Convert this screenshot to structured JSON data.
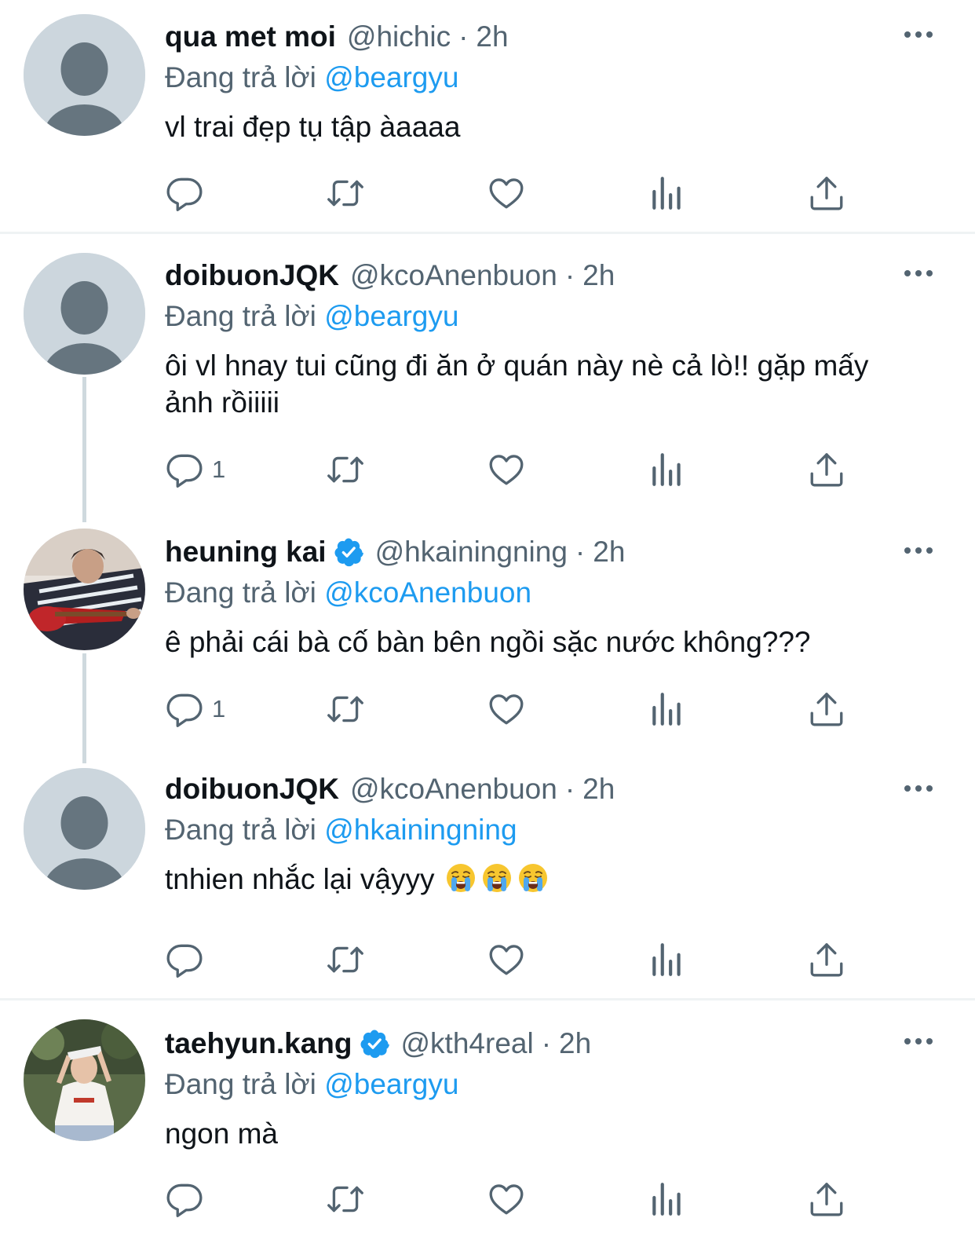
{
  "replying_prefix": "Đang trả lời",
  "tweets": [
    {
      "name": "qua met moi",
      "handle": "@hichic",
      "time": "2h",
      "replying_to": "@beargyu",
      "text": "vl trai đẹp tụ tập àaaaa",
      "reply_count": ""
    },
    {
      "name": "doibuonJQK",
      "handle": "@kcoAnenbuon",
      "time": "2h",
      "replying_to": "@beargyu",
      "text": "ôi vl hnay tui cũng đi ăn ở quán này nè cả lò!! gặp mấy ảnh rồiiiii",
      "reply_count": "1"
    },
    {
      "name": "heuning kai",
      "handle": "@hkainingning",
      "time": "2h",
      "replying_to": "@kcoAnenbuon",
      "text": "ê phải cái bà cố bàn bên ngồi sặc nước không???",
      "reply_count": "1",
      "verified": true
    },
    {
      "name": "doibuonJQK",
      "handle": "@kcoAnenbuon",
      "time": "2h",
      "replying_to": "@hkainingning",
      "text": "tnhien nhắc lại vậyyy",
      "reply_count": "",
      "emojis": [
        "loudly-crying-face-emoji",
        "loudly-crying-face-emoji",
        "loudly-crying-face-emoji"
      ]
    },
    {
      "name": "taehyun.kang",
      "handle": "@kth4real",
      "time": "2h",
      "replying_to": "@beargyu",
      "text": "ngon mà",
      "reply_count": "",
      "verified": true
    }
  ],
  "separator": "·",
  "colors": {
    "text": "#0f1419",
    "secondary": "#536471",
    "link": "#1d9bf0",
    "divider": "#eff3f4",
    "thread_line": "#cfd9de",
    "default_avatar_bg": "#ccd6dd",
    "default_avatar_fg": "#66757f"
  },
  "icons": [
    "reply-icon",
    "retweet-icon",
    "like-icon",
    "views-icon",
    "share-icon",
    "more-icon",
    "verified-badge-icon"
  ]
}
